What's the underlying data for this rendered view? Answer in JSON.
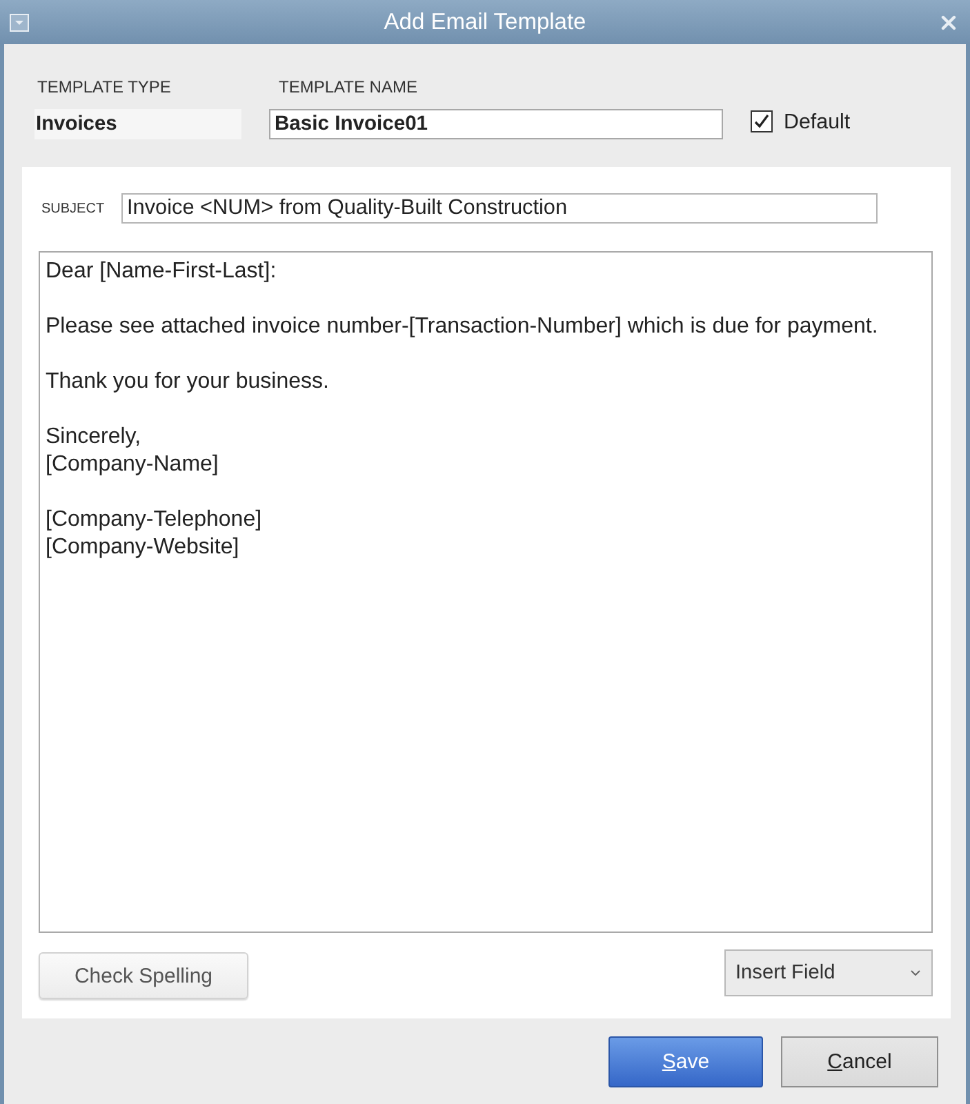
{
  "window": {
    "title": "Add Email Template"
  },
  "template_type": {
    "label": "TEMPLATE TYPE",
    "value": "Invoices"
  },
  "template_name": {
    "label": "TEMPLATE NAME",
    "value": "Basic Invoice01"
  },
  "default_checkbox": {
    "label": "Default",
    "checked": true
  },
  "subject": {
    "label": "SUBJECT",
    "value": "Invoice <NUM> from Quality-Built Construction"
  },
  "body": {
    "paragraphs": [
      [
        "Dear [Name-First-Last]:"
      ],
      [
        "Please see attached invoice number-[Transaction-Number] which is due for payment."
      ],
      [
        "Thank you for your business."
      ],
      [
        "Sincerely,",
        "[Company-Name]"
      ],
      [
        "[Company-Telephone]",
        "[Company-Website]"
      ]
    ]
  },
  "check_spelling_button": {
    "label": "Check Spelling"
  },
  "insert_field_dropdown": {
    "label": "Insert Field"
  },
  "buttons": [
    {
      "label": "Save",
      "kind": "primary"
    },
    {
      "label": "Cancel",
      "kind": "secondary"
    }
  ]
}
